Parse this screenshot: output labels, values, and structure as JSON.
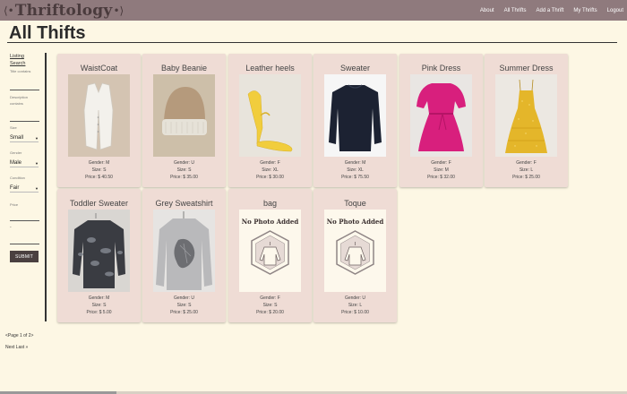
{
  "brand": {
    "name": "Thriftology"
  },
  "nav": [
    {
      "label": "About"
    },
    {
      "label": "All Thrifts"
    },
    {
      "label": "Add a Thrift"
    },
    {
      "label": "My Thrifts"
    },
    {
      "label": "Logout"
    }
  ],
  "page": {
    "title": "All Thifts"
  },
  "sidebar": {
    "title_line1": "Listing",
    "title_line2": "Search",
    "title_contains_label": "Title contains",
    "description_label_1": "Description",
    "description_label_2": "contains",
    "size_label": "Size",
    "size_value": "Small",
    "gender_label": "Gender",
    "gender_value": "Male",
    "condition_label": "Condition",
    "condition_value": "Fair",
    "price_label": "Price",
    "price_separator": "-",
    "submit_label": "SUBMIT"
  },
  "cards": [
    {
      "title": "WaistCoat",
      "gender": "Gender: M",
      "size": "Size: S",
      "price": "Price: $ 40.50",
      "image": "vest"
    },
    {
      "title": "Baby Beanie",
      "gender": "Gender: U",
      "size": "Size: S",
      "price": "Price: $ 35.00",
      "image": "beanie"
    },
    {
      "title": "Leather heels",
      "gender": "Gender: F",
      "size": "Size: XL",
      "price": "Price: $ 30.00",
      "image": "heels"
    },
    {
      "title": "Sweater",
      "gender": "Gender: M",
      "size": "Size: XL",
      "price": "Price: $ 75.50",
      "image": "sweater"
    },
    {
      "title": "Pink Dress",
      "gender": "Gender: F",
      "size": "Size: M",
      "price": "Price: $ 32.00",
      "image": "pink-dress"
    },
    {
      "title": "Summer Dress",
      "gender": "Gender: F",
      "size": "Size: L",
      "price": "Price: $ 25.00",
      "image": "summer-dress"
    },
    {
      "title": "Toddler Sweater",
      "gender": "Gender: M",
      "size": "Size: S",
      "price": "Price: $ 5.00",
      "image": "toddler-sweater"
    },
    {
      "title": "Grey Sweatshirt",
      "gender": "Gender: U",
      "size": "Size: S",
      "price": "Price: $ 25.00",
      "image": "grey-sweatshirt"
    },
    {
      "title": "bag",
      "gender": "Gender: F",
      "size": "Size: S",
      "price": "Price: $ 20.00",
      "image": "no-photo",
      "placeholder_text": "No Photo Added"
    },
    {
      "title": "Toque",
      "gender": "Gender: U",
      "size": "Size: L",
      "price": "Price: $ 10.00",
      "image": "no-photo",
      "placeholder_text": "No Photo Added"
    }
  ],
  "pagination": {
    "page_info": "<Page 1 of 2>",
    "next": "Next",
    "last": "Last »"
  },
  "colors": {
    "background": "#fdf7e4",
    "navbar": "#8f7a7d",
    "card": "#efdcd5",
    "button": "#4a4040"
  }
}
